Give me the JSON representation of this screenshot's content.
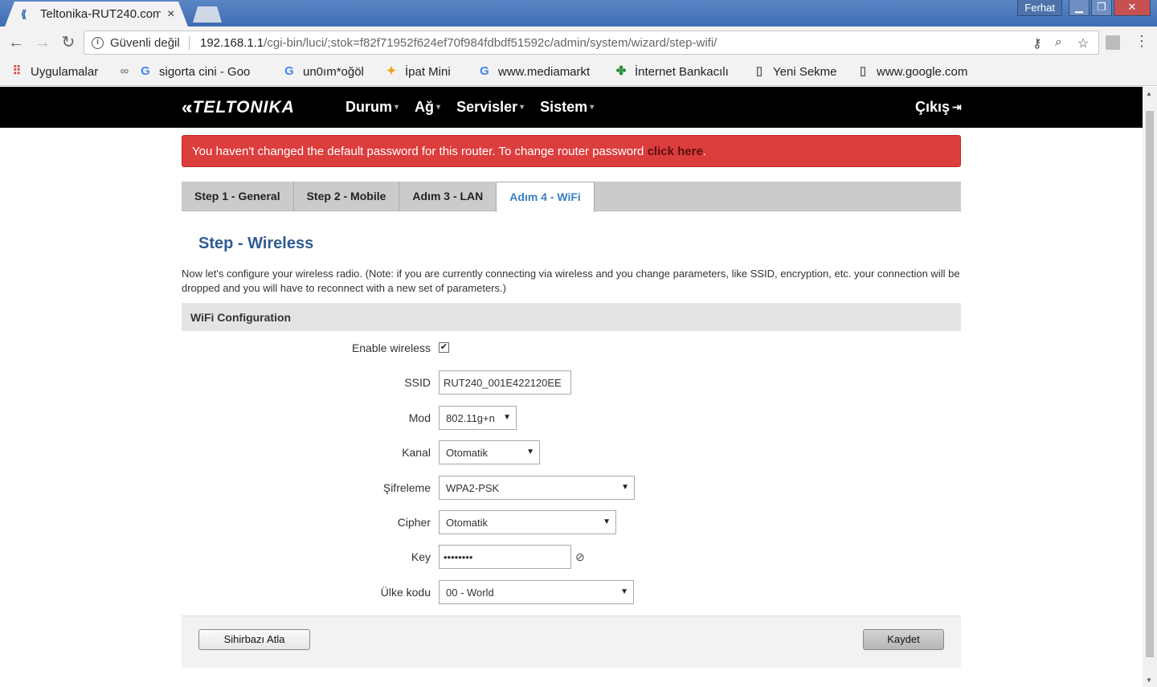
{
  "browser": {
    "tab_title": "Teltonika-RUT240.com",
    "tab_close": "×",
    "window_user": "Ferhat",
    "security_label": "Güvenli değil",
    "url_host": "192.168.1.1",
    "url_path": "/cgi-bin/luci/;stok=f82f71952f624ef70f984fdbdf51592c/admin/system/wizard/step-wifi/",
    "bookmarks": [
      {
        "icon": "apps-grid-icon",
        "label": "Uygulamalar"
      },
      {
        "icon": "google-icon",
        "label": "sigorta cini - Goo"
      },
      {
        "icon": "google-icon",
        "label": "un0ım*oğöl"
      },
      {
        "icon": "pinwheel-icon",
        "label": "İpat Mini"
      },
      {
        "icon": "google-icon",
        "label": "www.mediamarkt"
      },
      {
        "icon": "clover-icon",
        "label": "İnternet Bankacılı"
      },
      {
        "icon": "page-icon",
        "label": "Yeni Sekme"
      },
      {
        "icon": "page-icon",
        "label": "www.google.com"
      }
    ]
  },
  "router": {
    "logo": "TELTONIKA",
    "menu": [
      "Durum",
      "Ağ",
      "Servisler",
      "Sistem"
    ],
    "logout": "Çıkış",
    "alert_text": "You haven't changed the default password for this router. To change router password ",
    "alert_link": "click here",
    "alert_suffix": ".",
    "steps": [
      "Step 1 - General",
      "Step 2 - Mobile",
      "Adım 3 - LAN",
      "Adım 4 - WiFi"
    ],
    "active_step": 3,
    "title": "Step - Wireless",
    "description": "Now let's configure your wireless radio. (Note: if you are currently connecting via wireless and you change parameters, like SSID, encryption, etc. your connection will be dropped and you will have to reconnect with a new set of parameters.)",
    "section": "WiFi Configuration",
    "fields": {
      "enable_label": "Enable wireless",
      "enable_checked": "✔",
      "ssid_label": "SSID",
      "ssid_value": "RUT240_001E422120EE",
      "mode_label": "Mod",
      "mode_value": "802.11g+n",
      "channel_label": "Kanal",
      "channel_value": "Otomatik",
      "encryption_label": "Şifreleme",
      "encryption_value": "WPA2-PSK",
      "cipher_label": "Cipher",
      "cipher_value": "Otomatik",
      "key_label": "Key",
      "key_value": "••••••••",
      "country_label": "Ülke kodu",
      "country_value": "00 - World"
    },
    "skip_button": "Sihirbazı Atla",
    "save_button": "Kaydet"
  },
  "colors": {
    "alert": "#dc3d3d",
    "title": "#2f5c92",
    "active_tab": "#3b7fc0"
  }
}
